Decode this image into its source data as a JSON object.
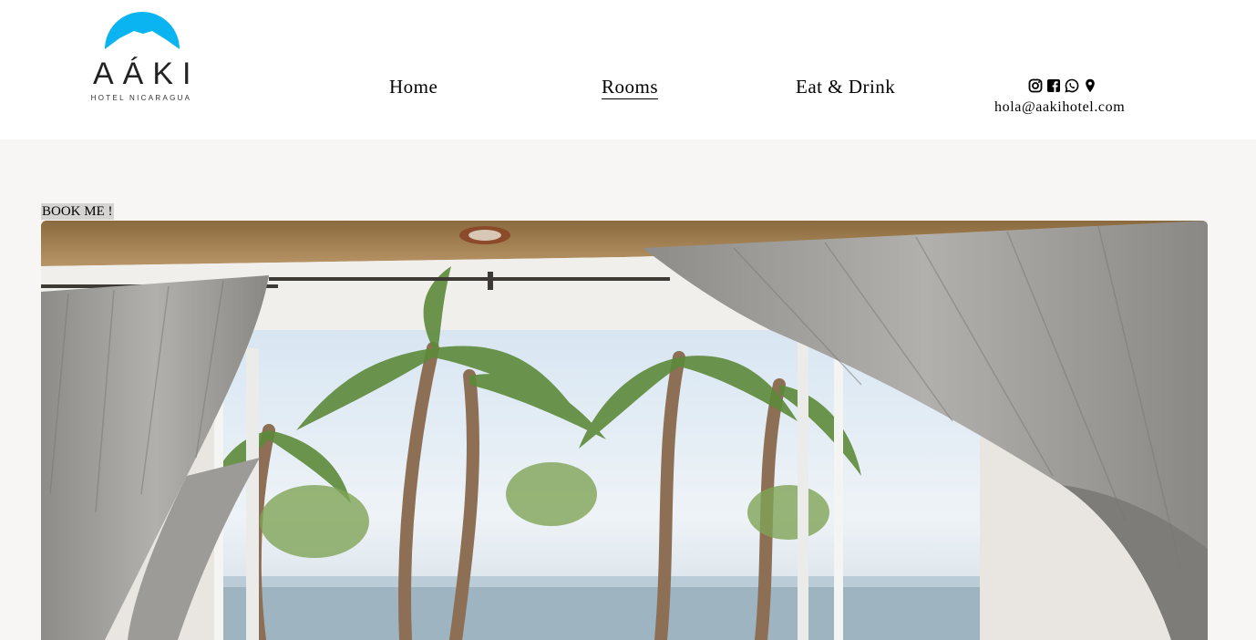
{
  "header": {
    "logo": {
      "wordmark": "AÁKI",
      "subtitle": "HOTEL NICARAGUA",
      "accent_color": "#0ab4f0"
    },
    "nav": [
      {
        "label": "Home",
        "active": false
      },
      {
        "label": "Rooms",
        "active": true
      },
      {
        "label": "Eat & Drink",
        "active": false
      }
    ],
    "social_icons": [
      "instagram-icon",
      "facebook-icon",
      "whatsapp-icon",
      "map-pin-icon"
    ],
    "email": "hola@aakihotel.com"
  },
  "main": {
    "book_label": "BOOK ME !",
    "photo": "room-window-ocean-palms"
  }
}
